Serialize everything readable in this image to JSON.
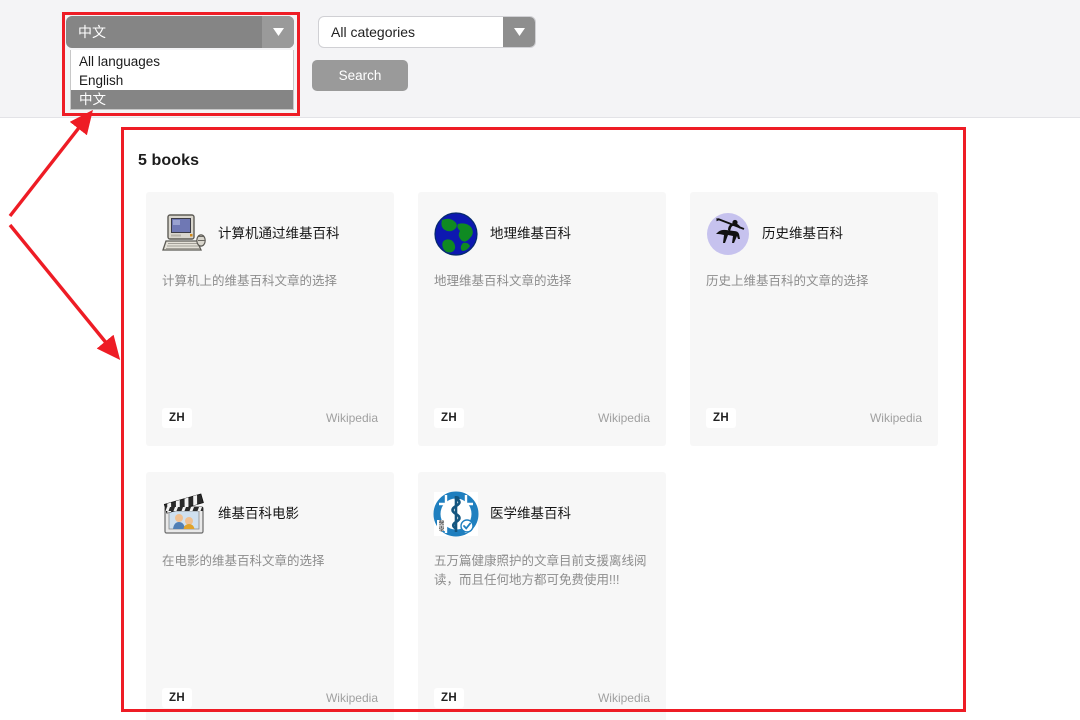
{
  "toolbar": {
    "language_select": {
      "name": "language-select",
      "value": "中文",
      "arrow_icon": "chevron-down-icon",
      "expanded": true,
      "options": [
        {
          "label": "All languages",
          "selected": false
        },
        {
          "label": "English",
          "selected": false
        },
        {
          "label": "中文",
          "selected": true
        }
      ]
    },
    "category_select": {
      "name": "category-select",
      "value": "All categories",
      "arrow_icon": "chevron-down-icon",
      "expanded": false
    },
    "search_button_label": "Search"
  },
  "results": {
    "heading": "5 books",
    "books": [
      {
        "title": "计算机通过维基百科",
        "description": "计算机上的维基百科文章的选择",
        "language_code": "ZH",
        "source": "Wikipedia",
        "icon": "vintage-computer-icon"
      },
      {
        "title": "地理维基百科",
        "description": "地理维基百科文章的选择",
        "language_code": "ZH",
        "source": "Wikipedia",
        "icon": "globe-icon"
      },
      {
        "title": "历史维基百科",
        "description": "历史上维基百科的文章的选择",
        "language_code": "ZH",
        "source": "Wikipedia",
        "icon": "centaur-history-icon"
      },
      {
        "title": "维基百科电影",
        "description": "在电影的维基百科文章的选择",
        "language_code": "ZH",
        "source": "Wikipedia",
        "icon": "movie-clapperboard-icon"
      },
      {
        "title": "医学维基百科",
        "description": "五万篇健康照护的文章目前支援离线阅读，而且任何地方都可免费使用!!!",
        "language_code": "ZH",
        "source": "Wikipedia",
        "icon": "rod-of-asclepius-icon"
      }
    ]
  },
  "annotations": {
    "highlight_color": "#ee1c25",
    "boxes": [
      "language-dropdown-highlight",
      "results-panel-highlight"
    ],
    "arrows": [
      "arrow-to-language-dropdown",
      "arrow-to-results-panel"
    ]
  },
  "colors": {
    "toolbar_bg": "#f4f4f6",
    "control_gray": "#858585",
    "card_bg": "#f7f7f7",
    "muted_text": "#8d8d8d",
    "annotation_red": "#ee1c25"
  }
}
